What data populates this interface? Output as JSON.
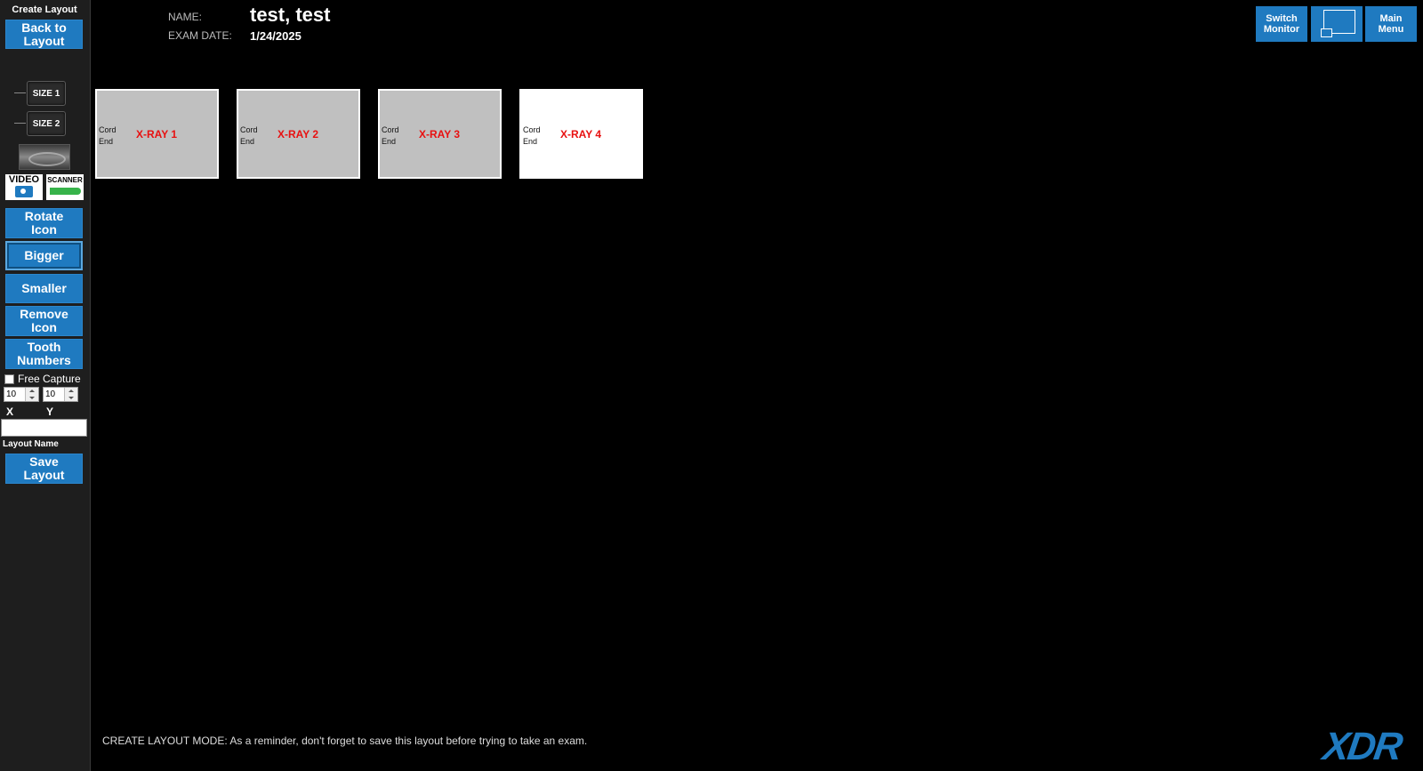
{
  "sidebar": {
    "title": "Create Layout",
    "back_to_layout": "Back to\nLayout",
    "size1": "SIZE 1",
    "size2": "SIZE 2",
    "video_label": "VIDEO",
    "scanner_label": "SCANNER",
    "rotate_icon": "Rotate\nIcon",
    "bigger": "Bigger",
    "smaller": "Smaller",
    "remove_icon": "Remove\nIcon",
    "tooth_numbers": "Tooth\nNumbers",
    "free_capture": "Free Capture",
    "x_value": "10",
    "y_value": "10",
    "x_label": "X",
    "y_label": "Y",
    "layout_name_value": "",
    "layout_name_label": "Layout Name",
    "save_layout": "Save\nLayout"
  },
  "header": {
    "name_label": "NAME:",
    "name_value": "test, test",
    "exam_date_label": "EXAM DATE:",
    "exam_date_value": "1/24/2025"
  },
  "top_buttons": {
    "switch_monitor": "Switch\nMonitor",
    "main_menu": "Main\nMenu"
  },
  "xrays": [
    {
      "label": "X-RAY 1",
      "cord": "Cord\nEnd"
    },
    {
      "label": "X-RAY 2",
      "cord": "Cord\nEnd"
    },
    {
      "label": "X-RAY 3",
      "cord": "Cord\nEnd"
    },
    {
      "label": "X-RAY 4",
      "cord": "Cord\nEnd"
    }
  ],
  "footer_message": "CREATE LAYOUT MODE: As a reminder, don't forget to save this layout before trying to take an exam.",
  "logo": "XDR",
  "colors": {
    "accent_blue": "#1f7ac0",
    "xray_label_red": "#e81010",
    "sidebar_bg": "#1e1e1e"
  }
}
